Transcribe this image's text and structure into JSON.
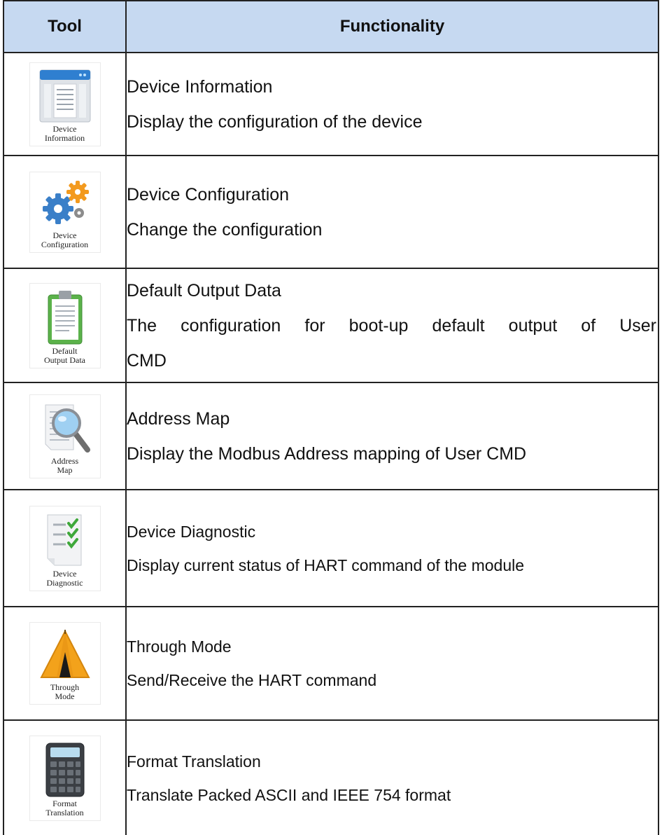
{
  "header": {
    "tool": "Tool",
    "functionality": "Functionality"
  },
  "rows": [
    {
      "icon": "device-information-icon",
      "caption": "Device\nInformation",
      "lines": [
        "Device Information",
        "Display the configuration of the device"
      ]
    },
    {
      "icon": "gears-icon",
      "caption": "Device\nConfiguration",
      "lines": [
        "Device Configuration",
        "Change the configuration"
      ]
    },
    {
      "icon": "clipboard-icon",
      "caption": "Default\nOutput Data",
      "lines": [
        "Default Output Data",
        "The configuration for boot-up default output of User",
        "CMD"
      ]
    },
    {
      "icon": "magnifier-icon",
      "caption": "Address\nMap",
      "lines": [
        "Address Map",
        "Display the Modbus Address mapping of User CMD"
      ]
    },
    {
      "icon": "checklist-icon",
      "caption": "Device\nDiagnostic",
      "lines": [
        "Device Diagnostic",
        "Display current status of HART command of the module"
      ]
    },
    {
      "icon": "tent-icon",
      "caption": "Through\nMode",
      "lines": [
        "Through Mode",
        "Send/Receive the HART command"
      ]
    },
    {
      "icon": "calculator-icon",
      "caption": "Format\nTranslation",
      "lines": [
        "Format Translation",
        "Translate Packed ASCII and IEEE 754 format"
      ]
    }
  ]
}
